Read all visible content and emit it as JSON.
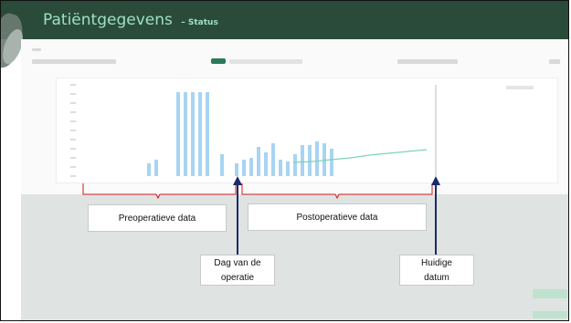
{
  "slide": {
    "title": "Patiëntgegevens",
    "subtitle": "Status"
  },
  "annotations": {
    "pre_label": "Preoperatieve data",
    "post_label": "Postoperatieve data",
    "op_day_label": "Dag van de operatie",
    "today_label": "Huidige datum"
  },
  "colors": {
    "header_bg": "#2a4a3a",
    "title_color": "#9de0c2",
    "bar_color": "#a8d4f2",
    "bracket_color": "#d11a1a",
    "arrow_color": "#1b2a6b",
    "trend_color": "#7fd3b3"
  },
  "chart_data": {
    "type": "bar",
    "title": "",
    "xlabel": "",
    "ylabel": "",
    "ylim": [
      0,
      100
    ],
    "values": [
      14,
      18,
      0,
      0,
      92,
      92,
      92,
      92,
      92,
      0,
      24,
      0,
      14,
      18,
      20,
      32,
      26,
      36,
      18,
      16,
      24,
      34,
      34,
      38,
      36,
      30
    ],
    "trend": [
      15,
      16,
      18,
      20,
      23,
      25,
      27,
      29
    ],
    "today_index": 25
  }
}
